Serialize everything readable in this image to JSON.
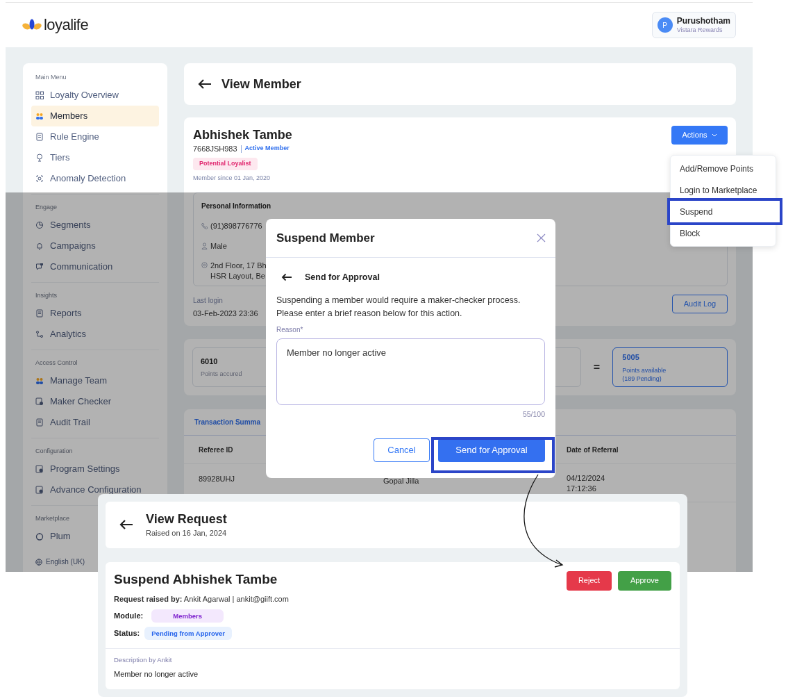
{
  "header": {
    "logo_text": "loyalife",
    "user": {
      "initial": "P",
      "name": "Purushotham",
      "subtitle": "Vistara Rewards"
    }
  },
  "sidebar": {
    "sections": [
      {
        "title": "Main Menu",
        "items": [
          {
            "label": "Loyalty Overview",
            "selected": false
          },
          {
            "label": "Members",
            "selected": true
          },
          {
            "label": "Rule Engine",
            "selected": false
          },
          {
            "label": "Tiers",
            "selected": false
          },
          {
            "label": "Anomaly Detection",
            "selected": false
          }
        ]
      },
      {
        "title": "Engage",
        "items": [
          {
            "label": "Segments",
            "selected": false
          },
          {
            "label": "Campaigns",
            "selected": false
          },
          {
            "label": "Communication",
            "selected": false
          }
        ]
      },
      {
        "title": "Insights",
        "items": [
          {
            "label": "Reports",
            "selected": false
          },
          {
            "label": "Analytics",
            "selected": false
          }
        ]
      },
      {
        "title": "Access Control",
        "items": [
          {
            "label": "Manage Team",
            "selected": false
          },
          {
            "label": "Maker Checker",
            "selected": false
          },
          {
            "label": "Audit Trail",
            "selected": false
          }
        ]
      },
      {
        "title": "Configuration",
        "items": [
          {
            "label": "Program Settings",
            "selected": false
          },
          {
            "label": "Advance Configuration",
            "selected": false
          }
        ]
      },
      {
        "title": "Marketplace",
        "items": [
          {
            "label": "Plum",
            "selected": false
          }
        ]
      }
    ],
    "language": "English (UK)"
  },
  "page_header": {
    "title": "View Member"
  },
  "member": {
    "name": "Abhishek Tambe",
    "id": "7668JSH983",
    "status": "Active Member",
    "segment": "Potential Loyalist",
    "since": "Member since 01 Jan, 2020",
    "actions_button": "Actions",
    "personal_info": {
      "title": "Personal Information",
      "phone": "(91)898776776",
      "gender": "Male",
      "address_lines": [
        "2nd Floor, 17 Bh",
        "HSR Layout, Be"
      ]
    },
    "last_login_label": "Last login",
    "last_login": "03-Feb-2023 23:36",
    "audit_button": "Audit Log"
  },
  "points": {
    "accrued": {
      "value": "6010",
      "label": "Points accured"
    },
    "operator": "=",
    "available": {
      "value": "5005",
      "label_lines": [
        "Points available",
        "(189 Pending)"
      ]
    }
  },
  "transactions": {
    "tab": "Transaction Summa",
    "columns": [
      "Referee ID",
      "Date of Referral"
    ],
    "rows": [
      {
        "referee_id": "89928UHJ",
        "column_2": "Gopal Jilla",
        "date": "04/12/2024",
        "time": "17:12:36"
      }
    ]
  },
  "actions_menu": {
    "items": [
      {
        "label": "Add/Remove Points",
        "highlighted": false
      },
      {
        "label": "Login to Marketplace",
        "highlighted": false
      },
      {
        "label": "Suspend",
        "highlighted": true
      },
      {
        "label": "Block",
        "highlighted": false
      }
    ]
  },
  "modal": {
    "title": "Suspend Member",
    "subtitle": "Send for Approval",
    "message": "Suspending a member would require a maker-checker process. Please enter a brief reason below for this action.",
    "reason_label": "Reason*",
    "reason_value": "Member no longer active",
    "counter": "55/100",
    "cancel_button": "Cancel",
    "submit_button": {
      "label": "Send for Approval",
      "highlighted": true
    }
  },
  "request": {
    "title": "View Request",
    "raised_on": "Raised on 16 Jan, 2024",
    "heading": "Suspend Abhishek Tambe",
    "raised_by": "**Request raised by:** Ankit Agarwal | ankit@giift.com",
    "module_label": "Module:",
    "module": "Members",
    "status_label": "Status:",
    "status": "Pending from Approver",
    "reject_button": "Reject",
    "approve_button": "Approve",
    "description_label": "Description by Ankit",
    "description": "Member no longer active"
  }
}
